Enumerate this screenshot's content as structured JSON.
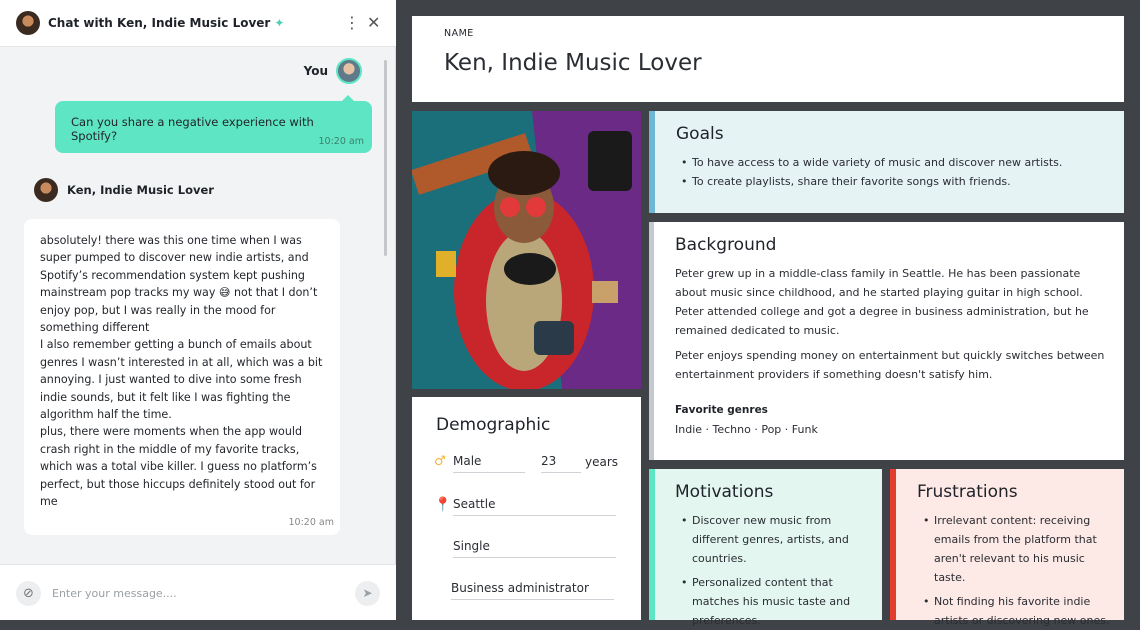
{
  "chat": {
    "title": "Chat with Ken, Indie Music Lover",
    "you_label": "You",
    "messages": [
      {
        "sender": "You",
        "text": "Can you share a negative experience with Spotify?",
        "time": "10:20 am"
      },
      {
        "sender": "Ken, Indie Music Lover",
        "text": "absolutely! there was this one time when I was super pumped to discover new indie artists, and Spotify’s recommendation system kept pushing mainstream pop tracks my way 😅 not that I don’t enjoy pop, but I was really in the mood for something different\nI also remember getting a bunch of emails about genres I wasn’t interested in at all, which was a bit annoying. I just wanted to dive into some fresh indie sounds, but it felt like I was fighting the algorithm half the time.\nplus, there were moments when the app would crash right in the middle of my favorite tracks, which was a total vibe killer. I guess no platform’s perfect, but those hiccups definitely stood out for me",
        "time": "10:20 am"
      }
    ],
    "input_placeholder": "Enter your message...."
  },
  "persona": {
    "name_label": "NAME",
    "name": "Ken, Indie Music Lover",
    "goals": {
      "title": "Goals",
      "items": [
        "To have access to a wide variety of music and discover new artists.",
        "To create playlists, share their favorite songs with friends."
      ]
    },
    "background": {
      "title": "Background",
      "paragraphs": [
        "Peter grew up in a middle-class family in Seattle. He has been passionate about music since childhood, and he started playing guitar in high school. Peter attended college and got a degree in business administration, but he remained dedicated to music.",
        "Peter enjoys spending money on entertainment but quickly switches between entertainment providers if something doesn't satisfy him."
      ],
      "genres_label": "Favorite genres",
      "genres": "Indie · Techno · Pop · Funk"
    },
    "demographic": {
      "title": "Demographic",
      "gender": "Male",
      "age": "23",
      "age_unit": "years",
      "location": "Seattle",
      "status": "Single",
      "occupation": "Business administrator"
    },
    "motivations": {
      "title": "Motivations",
      "items": [
        "Discover new music from different genres, artists, and countries.",
        "Personalized content that matches his music taste and preferences."
      ]
    },
    "frustrations": {
      "title": "Frustrations",
      "items": [
        "Irrelevant content: receiving emails from the platform that aren't relevant to his music taste.",
        "Not finding his favorite indie artists or discovering new ones."
      ]
    }
  },
  "colors": {
    "accent_green": "#5ee5c3",
    "goals_accent": "#6fb6d4",
    "frustrations_accent": "#e33e2b",
    "location_icon": "#f2b53a"
  }
}
